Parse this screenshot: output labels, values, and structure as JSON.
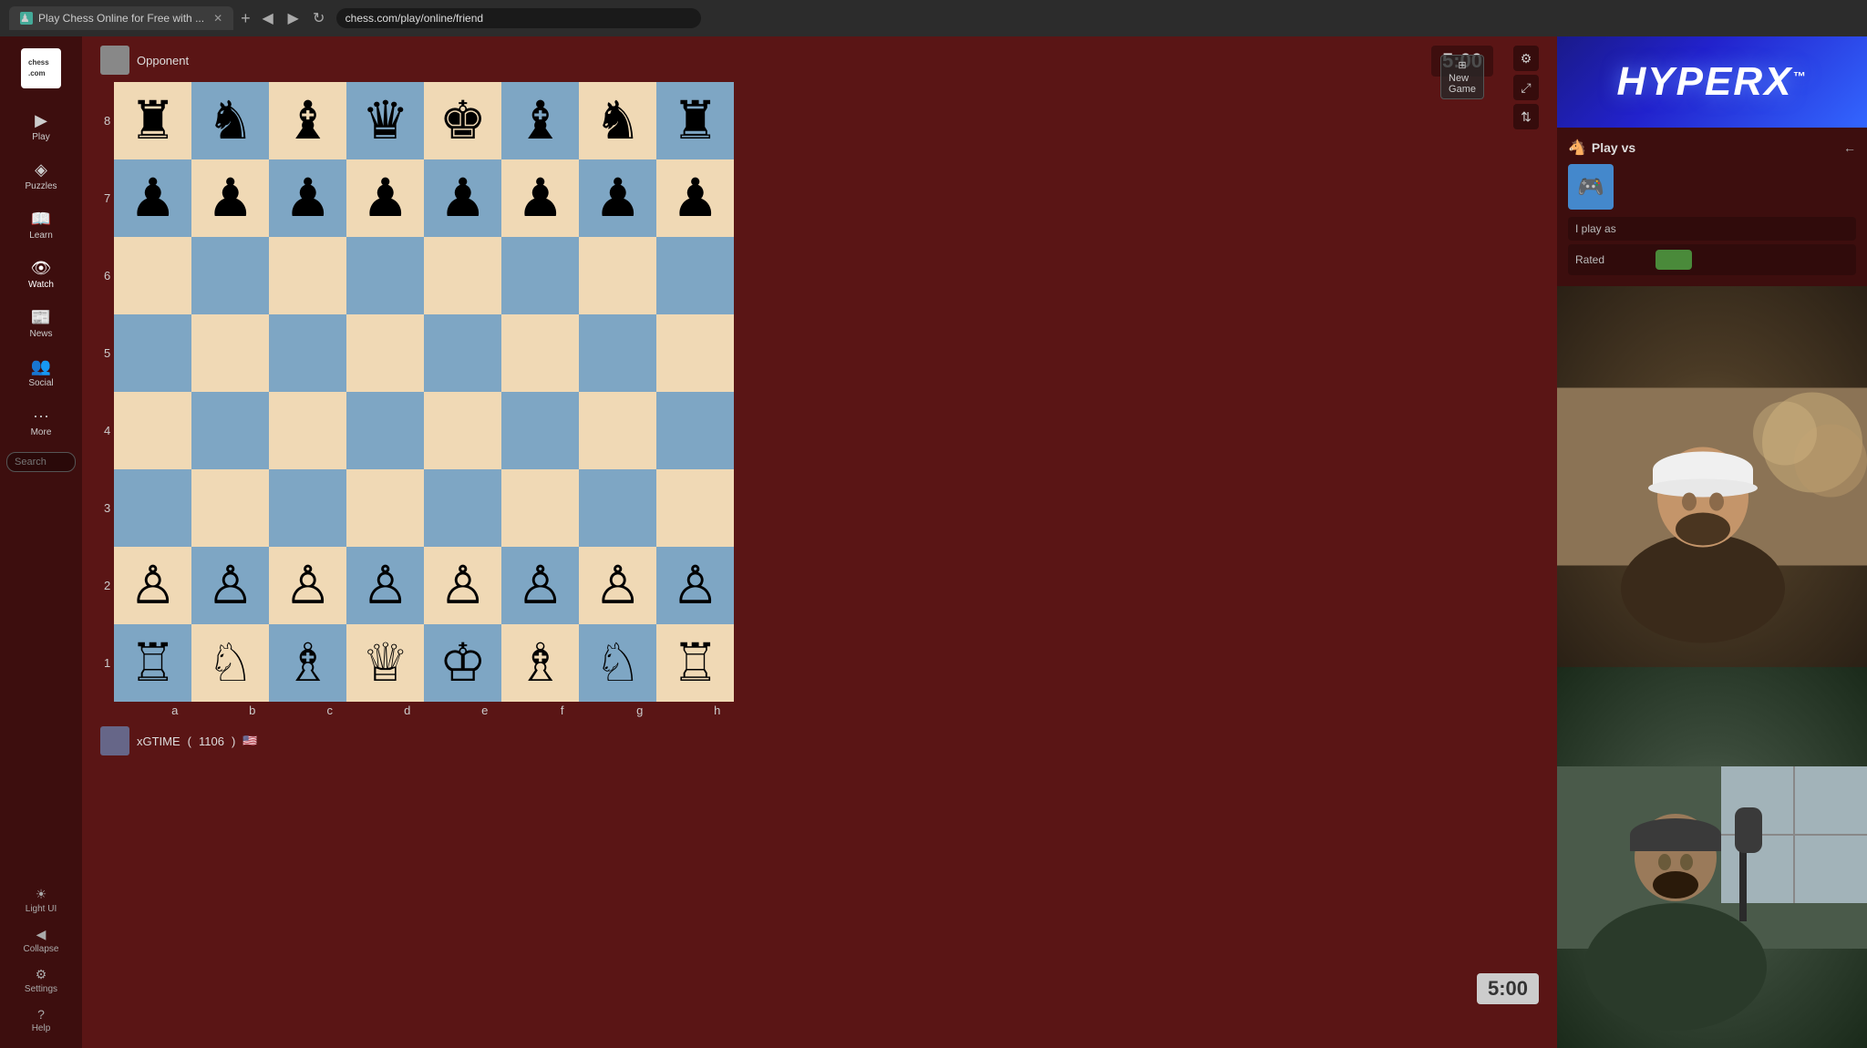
{
  "browser": {
    "tab_title": "Play Chess Online for Free with ...",
    "url": "chess.com/play/online/friend",
    "favicon": "♟"
  },
  "sidebar": {
    "logo": "chess.com",
    "items": [
      {
        "id": "play",
        "label": "Play",
        "icon": "▶"
      },
      {
        "id": "puzzles",
        "label": "Puzzles",
        "icon": "🧩"
      },
      {
        "id": "learn",
        "label": "Learn",
        "icon": "📖"
      },
      {
        "id": "watch",
        "label": "Watch",
        "icon": "👁"
      },
      {
        "id": "news",
        "label": "News",
        "icon": "📰"
      },
      {
        "id": "social",
        "label": "Social",
        "icon": "👥"
      },
      {
        "id": "more",
        "label": "More",
        "icon": "···"
      }
    ],
    "search_placeholder": "Search",
    "bottom_items": [
      {
        "id": "light-ui",
        "label": "Light UI",
        "icon": "☀"
      },
      {
        "id": "collapse",
        "label": "Collapse",
        "icon": "◀"
      },
      {
        "id": "settings",
        "label": "Settings",
        "icon": "⚙"
      },
      {
        "id": "help",
        "label": "Help",
        "icon": "?"
      }
    ]
  },
  "game": {
    "opponent_name": "Opponent",
    "timer_top": "5:00",
    "timer_bottom": "5:00",
    "player_name": "xGTIME",
    "player_rating": "1106",
    "player_flag": "🇺🇸",
    "col_labels": [
      "a",
      "b",
      "c",
      "d",
      "e",
      "f",
      "g",
      "h"
    ],
    "row_labels": [
      "8",
      "7",
      "6",
      "5",
      "4",
      "3",
      "2",
      "1"
    ],
    "board": [
      [
        "♜",
        "♞",
        "♝",
        "♛",
        "♚",
        "♝",
        "♞",
        "♜"
      ],
      [
        "♟",
        "♟",
        "♟",
        "♟",
        "♟",
        "♟",
        "♟",
        "♟"
      ],
      [
        "",
        "",
        "",
        "",
        "",
        "",
        "",
        ""
      ],
      [
        "",
        "",
        "",
        "",
        "",
        "",
        "",
        ""
      ],
      [
        "",
        "",
        "",
        "",
        "",
        "",
        "",
        ""
      ],
      [
        "",
        "",
        "",
        "",
        "",
        "",
        "",
        ""
      ],
      [
        "♙",
        "♙",
        "♙",
        "♙",
        "♙",
        "♙",
        "♙",
        "♙"
      ],
      [
        "♖",
        "♘",
        "♗",
        "♕",
        "♔",
        "♗",
        "♘",
        "♖"
      ]
    ]
  },
  "right_panel": {
    "hyperx_label": "HYPERX",
    "hyperx_tm": "™",
    "play_vs_label": "Play vs",
    "i_play_as_label": "I play as",
    "rated_label": "Rated",
    "new_game_label": "New Game"
  }
}
